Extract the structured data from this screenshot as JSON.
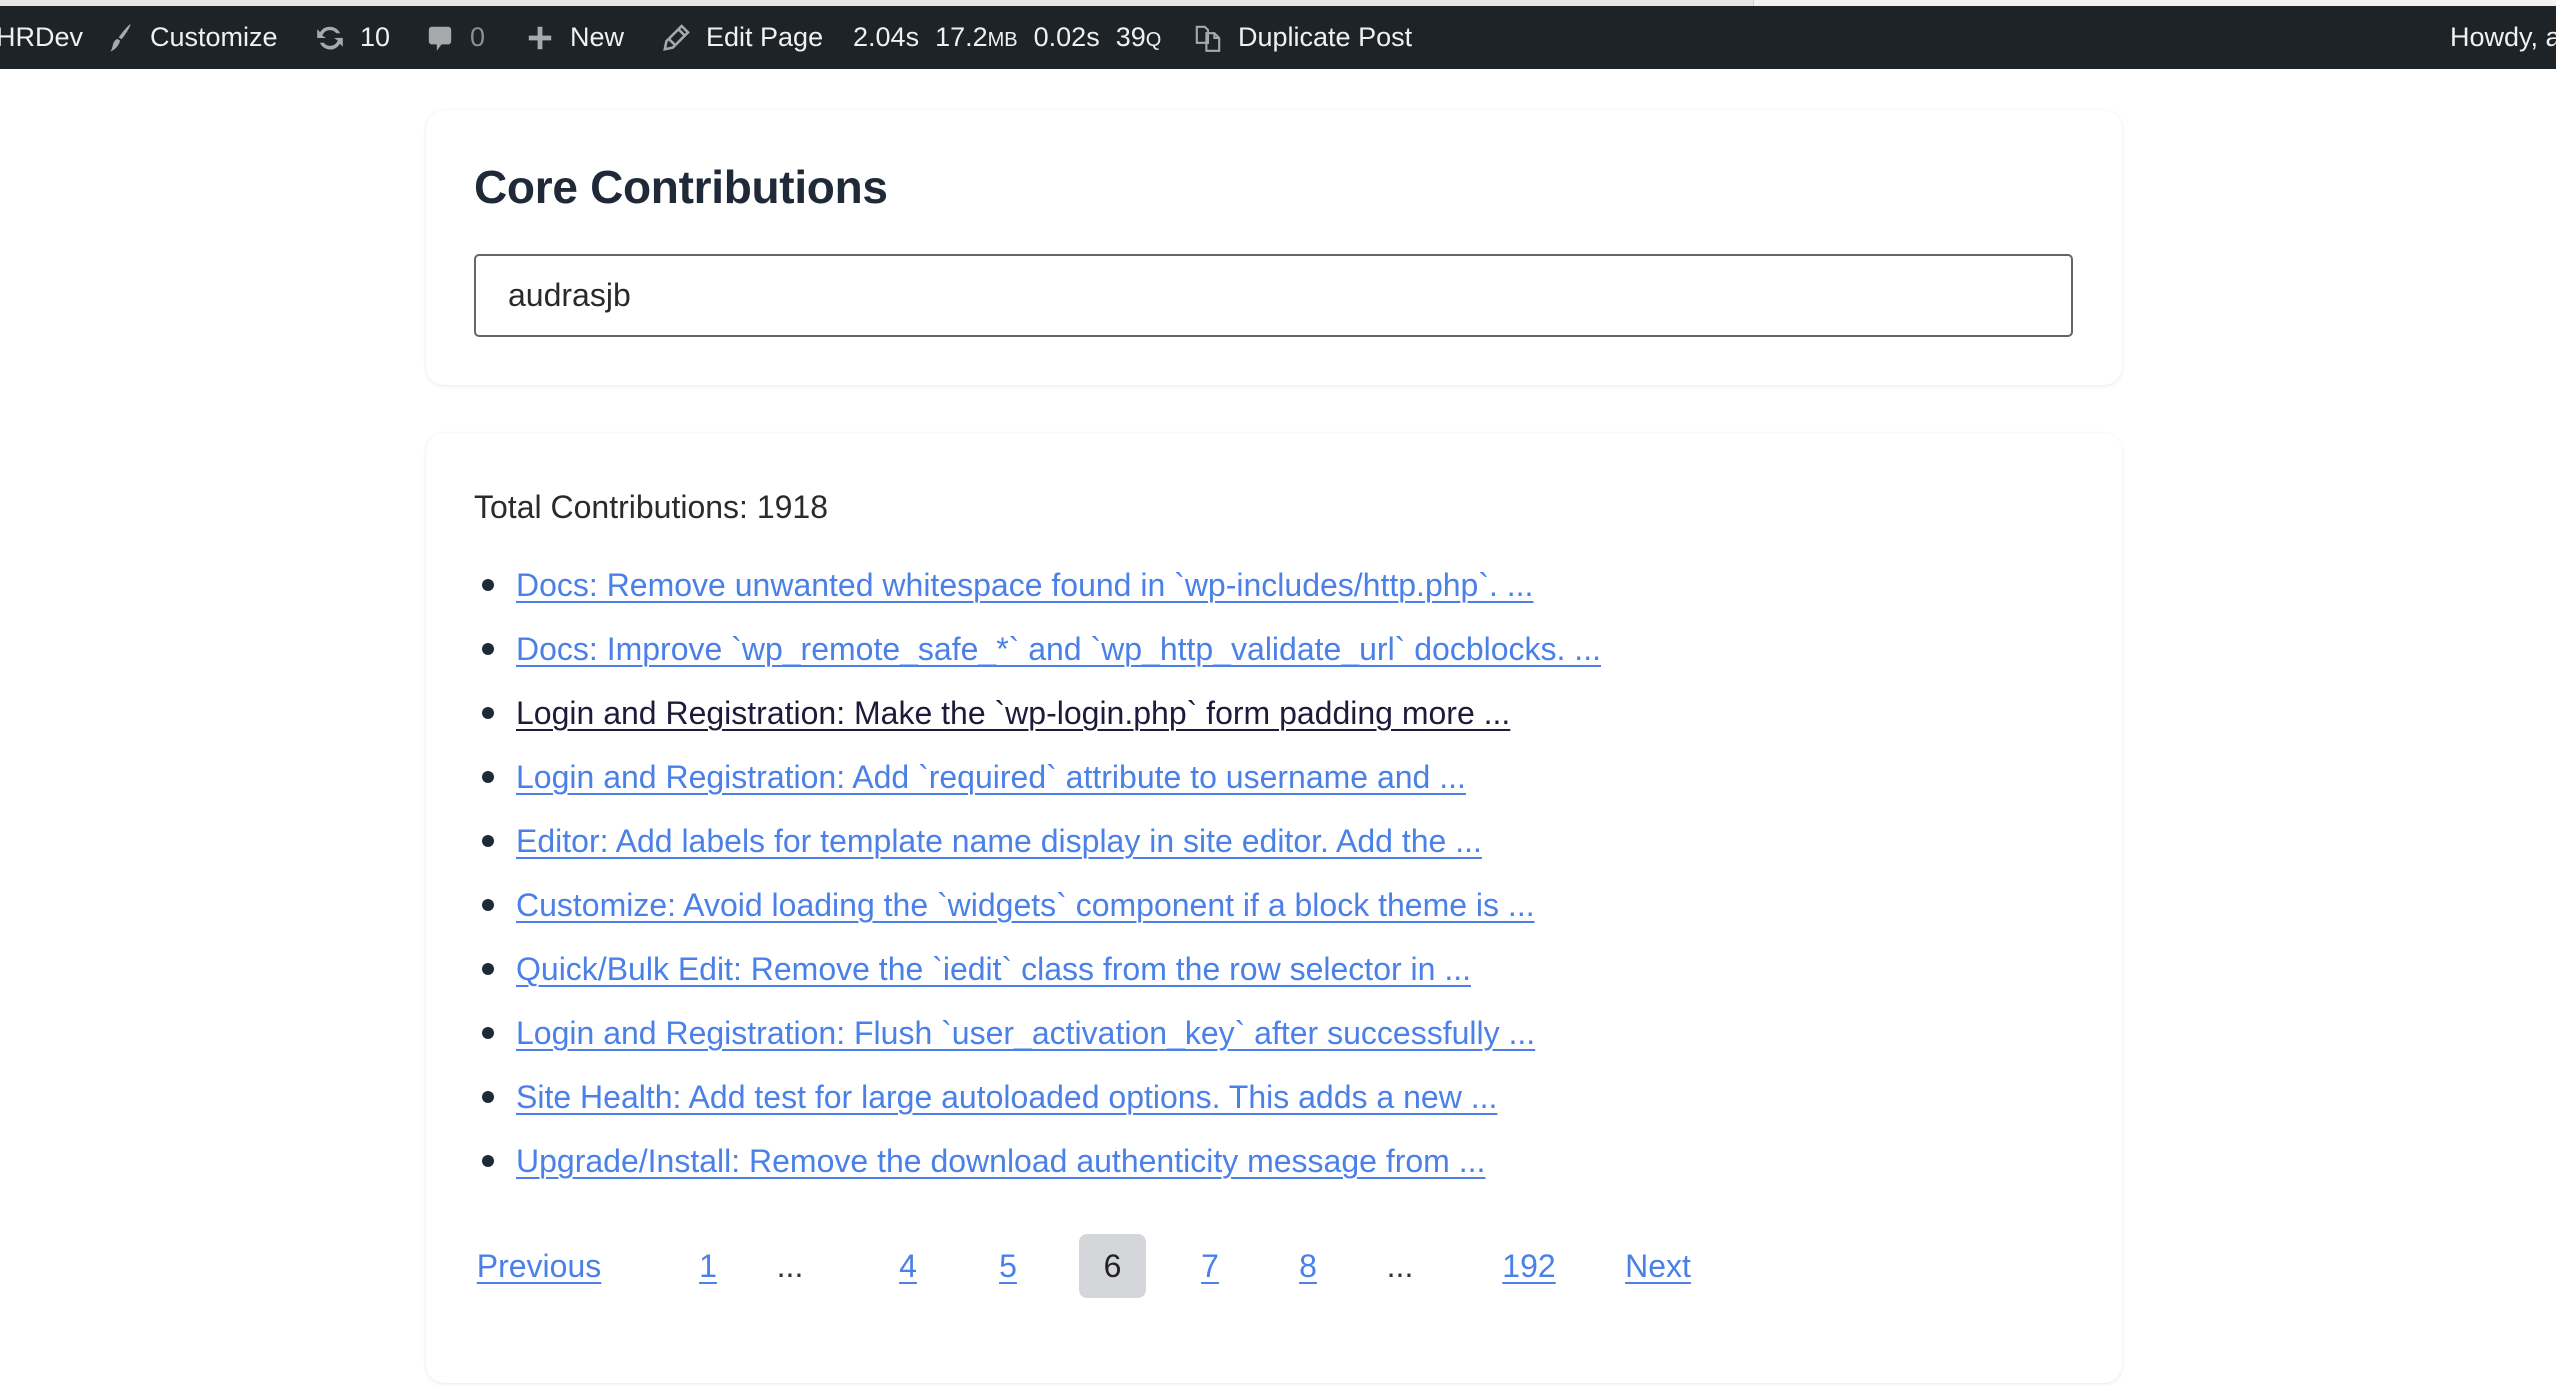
{
  "adminbar": {
    "site_name": "HRDev",
    "customize": {
      "icon": "paintbrush-icon",
      "label": "Customize"
    },
    "updates": {
      "icon": "refresh-icon",
      "count": "10"
    },
    "comments": {
      "icon": "comment-icon",
      "count": "0"
    },
    "new": {
      "icon": "plus-icon",
      "label": "New"
    },
    "edit_page": {
      "icon": "pencil-icon",
      "label": "Edit Page"
    },
    "query_monitor": {
      "time": "2.04",
      "time_unit": "s",
      "memory": "17.2",
      "memory_unit": "MB",
      "db_time": "0.02",
      "db_time_unit": "s",
      "queries": "39",
      "queries_unit": "Q"
    },
    "duplicate_post": {
      "icon": "duplicate-icon",
      "label": "Duplicate Post"
    },
    "howdy": "Howdy, a"
  },
  "search_card": {
    "title": "Core Contributions",
    "input_value": "audrasjb"
  },
  "results": {
    "total_label": "Total Contributions: 1918",
    "items": [
      {
        "text": "Docs: Remove unwanted whitespace found in `wp-includes/http.php`. ...",
        "visited": false
      },
      {
        "text": "Docs: Improve `wp_remote_safe_*` and `wp_http_validate_url` docblocks. ...",
        "visited": false
      },
      {
        "text": "Login and Registration: Make the `wp-login.php` form padding more ...",
        "visited": true
      },
      {
        "text": "Login and Registration: Add `required` attribute to username and ...",
        "visited": false
      },
      {
        "text": "Editor: Add labels for template name display in site editor. Add the ...",
        "visited": false
      },
      {
        "text": "Customize: Avoid loading the `widgets` component if a block theme is ...",
        "visited": false
      },
      {
        "text": "Quick/Bulk Edit: Remove the `iedit` class from the row selector in ...",
        "visited": false
      },
      {
        "text": "Login and Registration: Flush `user_activation_key` after successfully ...",
        "visited": false
      },
      {
        "text": "Site Health: Add test for large autoloaded options. This adds a new ...",
        "visited": false
      },
      {
        "text": "Upgrade/Install: Remove the download authenticity message from ...",
        "visited": false
      }
    ]
  },
  "pagination": {
    "previous": "Previous",
    "next": "Next",
    "pages": [
      {
        "label": "1",
        "type": "link"
      },
      {
        "label": "...",
        "type": "dots"
      },
      {
        "label": "4",
        "type": "link"
      },
      {
        "label": "5",
        "type": "link"
      },
      {
        "label": "6",
        "type": "current"
      },
      {
        "label": "7",
        "type": "link"
      },
      {
        "label": "8",
        "type": "link"
      },
      {
        "label": "...",
        "type": "dots"
      },
      {
        "label": "192",
        "type": "link"
      }
    ],
    "current_page": 6,
    "total_pages": 192
  },
  "colors": {
    "adminbar_bg": "#1d2327",
    "link": "#4a80e8",
    "visited_link": "#1e1b3a",
    "current_page_bg": "#d4d6da",
    "heading": "#1f2937"
  }
}
